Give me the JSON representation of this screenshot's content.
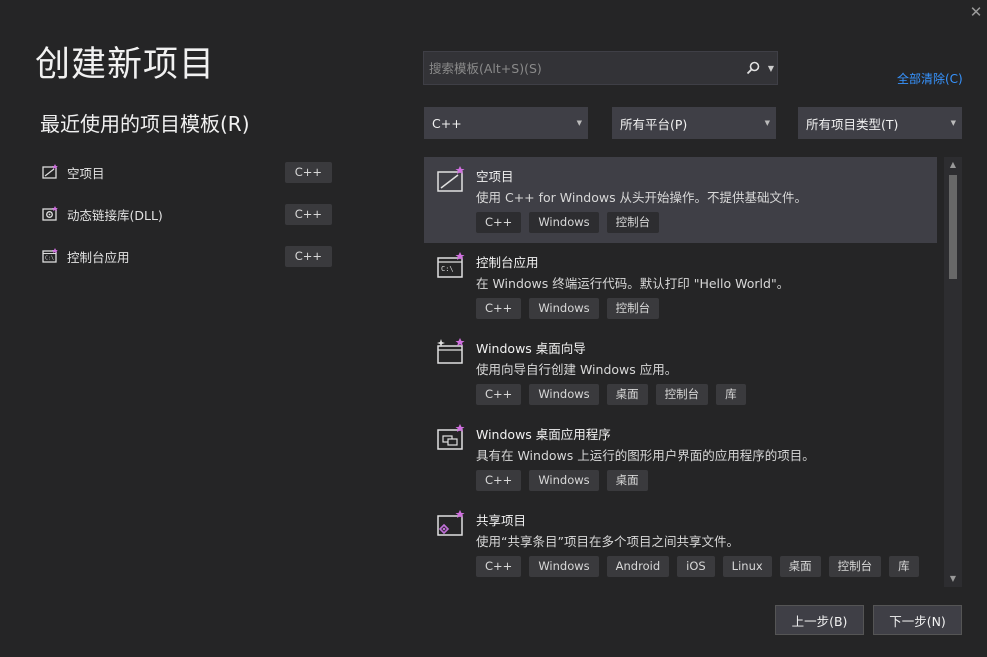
{
  "window": {
    "title": "创建新项目",
    "close_glyph": "✕"
  },
  "recent": {
    "title": "最近使用的项目模板(R)",
    "items": [
      {
        "icon": "empty-project-icon",
        "label": "空项目",
        "tag": "C++"
      },
      {
        "icon": "dll-icon",
        "label": "动态链接库(DLL)",
        "tag": "C++"
      },
      {
        "icon": "console-app-icon",
        "label": "控制台应用",
        "tag": "C++"
      }
    ]
  },
  "search": {
    "placeholder": "搜索模板(Alt+S)(S)",
    "value": ""
  },
  "clear_all": "全部清除(C)",
  "filters": {
    "language": "C++",
    "platform": "所有平台(P)",
    "project_type": "所有项目类型(T)"
  },
  "templates": [
    {
      "icon": "empty-project-icon",
      "title": "空项目",
      "desc": "使用 C++ for Windows 从头开始操作。不提供基础文件。",
      "tags": [
        "C++",
        "Windows",
        "控制台"
      ],
      "selected": true
    },
    {
      "icon": "console-app-icon",
      "title": "控制台应用",
      "desc": "在 Windows 终端运行代码。默认打印 \"Hello World\"。",
      "tags": [
        "C++",
        "Windows",
        "控制台"
      ]
    },
    {
      "icon": "desktop-wizard-icon",
      "title": "Windows 桌面向导",
      "desc": "使用向导自行创建 Windows 应用。",
      "tags": [
        "C++",
        "Windows",
        "桌面",
        "控制台",
        "库"
      ]
    },
    {
      "icon": "desktop-app-icon",
      "title": "Windows 桌面应用程序",
      "desc": "具有在 Windows 上运行的图形用户界面的应用程序的项目。",
      "tags": [
        "C++",
        "Windows",
        "桌面"
      ]
    },
    {
      "icon": "shared-project-icon",
      "title": "共享项目",
      "desc": "使用“共享条目”项目在多个项目之间共享文件。",
      "tags": [
        "C++",
        "Windows",
        "Android",
        "iOS",
        "Linux",
        "桌面",
        "控制台",
        "库"
      ]
    }
  ],
  "buttons": {
    "back": "上一步(B)",
    "next": "下一步(N)"
  },
  "colors": {
    "background": "#252526",
    "accent_link": "#3794ff",
    "selected": "#3f3f46"
  }
}
